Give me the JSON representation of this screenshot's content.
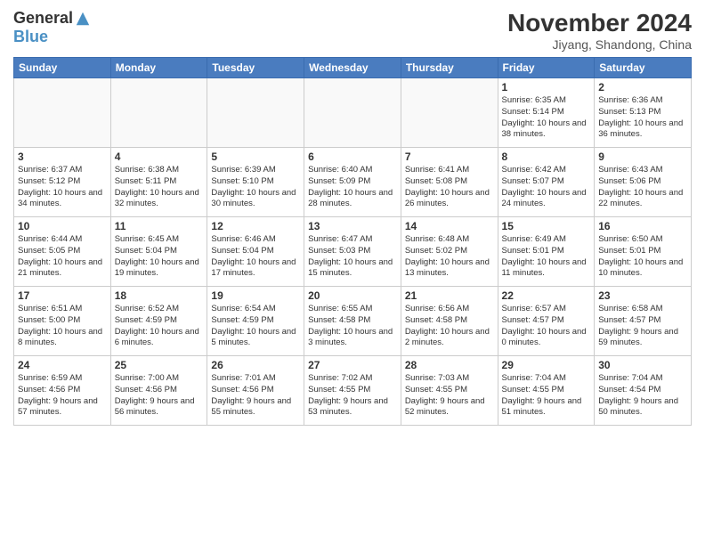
{
  "logo": {
    "general": "General",
    "blue": "Blue"
  },
  "title": "November 2024",
  "location": "Jiyang, Shandong, China",
  "days_of_week": [
    "Sunday",
    "Monday",
    "Tuesday",
    "Wednesday",
    "Thursday",
    "Friday",
    "Saturday"
  ],
  "weeks": [
    [
      {
        "day": "",
        "info": ""
      },
      {
        "day": "",
        "info": ""
      },
      {
        "day": "",
        "info": ""
      },
      {
        "day": "",
        "info": ""
      },
      {
        "day": "",
        "info": ""
      },
      {
        "day": "1",
        "info": "Sunrise: 6:35 AM\nSunset: 5:14 PM\nDaylight: 10 hours and 38 minutes."
      },
      {
        "day": "2",
        "info": "Sunrise: 6:36 AM\nSunset: 5:13 PM\nDaylight: 10 hours and 36 minutes."
      }
    ],
    [
      {
        "day": "3",
        "info": "Sunrise: 6:37 AM\nSunset: 5:12 PM\nDaylight: 10 hours and 34 minutes."
      },
      {
        "day": "4",
        "info": "Sunrise: 6:38 AM\nSunset: 5:11 PM\nDaylight: 10 hours and 32 minutes."
      },
      {
        "day": "5",
        "info": "Sunrise: 6:39 AM\nSunset: 5:10 PM\nDaylight: 10 hours and 30 minutes."
      },
      {
        "day": "6",
        "info": "Sunrise: 6:40 AM\nSunset: 5:09 PM\nDaylight: 10 hours and 28 minutes."
      },
      {
        "day": "7",
        "info": "Sunrise: 6:41 AM\nSunset: 5:08 PM\nDaylight: 10 hours and 26 minutes."
      },
      {
        "day": "8",
        "info": "Sunrise: 6:42 AM\nSunset: 5:07 PM\nDaylight: 10 hours and 24 minutes."
      },
      {
        "day": "9",
        "info": "Sunrise: 6:43 AM\nSunset: 5:06 PM\nDaylight: 10 hours and 22 minutes."
      }
    ],
    [
      {
        "day": "10",
        "info": "Sunrise: 6:44 AM\nSunset: 5:05 PM\nDaylight: 10 hours and 21 minutes."
      },
      {
        "day": "11",
        "info": "Sunrise: 6:45 AM\nSunset: 5:04 PM\nDaylight: 10 hours and 19 minutes."
      },
      {
        "day": "12",
        "info": "Sunrise: 6:46 AM\nSunset: 5:04 PM\nDaylight: 10 hours and 17 minutes."
      },
      {
        "day": "13",
        "info": "Sunrise: 6:47 AM\nSunset: 5:03 PM\nDaylight: 10 hours and 15 minutes."
      },
      {
        "day": "14",
        "info": "Sunrise: 6:48 AM\nSunset: 5:02 PM\nDaylight: 10 hours and 13 minutes."
      },
      {
        "day": "15",
        "info": "Sunrise: 6:49 AM\nSunset: 5:01 PM\nDaylight: 10 hours and 11 minutes."
      },
      {
        "day": "16",
        "info": "Sunrise: 6:50 AM\nSunset: 5:01 PM\nDaylight: 10 hours and 10 minutes."
      }
    ],
    [
      {
        "day": "17",
        "info": "Sunrise: 6:51 AM\nSunset: 5:00 PM\nDaylight: 10 hours and 8 minutes."
      },
      {
        "day": "18",
        "info": "Sunrise: 6:52 AM\nSunset: 4:59 PM\nDaylight: 10 hours and 6 minutes."
      },
      {
        "day": "19",
        "info": "Sunrise: 6:54 AM\nSunset: 4:59 PM\nDaylight: 10 hours and 5 minutes."
      },
      {
        "day": "20",
        "info": "Sunrise: 6:55 AM\nSunset: 4:58 PM\nDaylight: 10 hours and 3 minutes."
      },
      {
        "day": "21",
        "info": "Sunrise: 6:56 AM\nSunset: 4:58 PM\nDaylight: 10 hours and 2 minutes."
      },
      {
        "day": "22",
        "info": "Sunrise: 6:57 AM\nSunset: 4:57 PM\nDaylight: 10 hours and 0 minutes."
      },
      {
        "day": "23",
        "info": "Sunrise: 6:58 AM\nSunset: 4:57 PM\nDaylight: 9 hours and 59 minutes."
      }
    ],
    [
      {
        "day": "24",
        "info": "Sunrise: 6:59 AM\nSunset: 4:56 PM\nDaylight: 9 hours and 57 minutes."
      },
      {
        "day": "25",
        "info": "Sunrise: 7:00 AM\nSunset: 4:56 PM\nDaylight: 9 hours and 56 minutes."
      },
      {
        "day": "26",
        "info": "Sunrise: 7:01 AM\nSunset: 4:56 PM\nDaylight: 9 hours and 55 minutes."
      },
      {
        "day": "27",
        "info": "Sunrise: 7:02 AM\nSunset: 4:55 PM\nDaylight: 9 hours and 53 minutes."
      },
      {
        "day": "28",
        "info": "Sunrise: 7:03 AM\nSunset: 4:55 PM\nDaylight: 9 hours and 52 minutes."
      },
      {
        "day": "29",
        "info": "Sunrise: 7:04 AM\nSunset: 4:55 PM\nDaylight: 9 hours and 51 minutes."
      },
      {
        "day": "30",
        "info": "Sunrise: 7:04 AM\nSunset: 4:54 PM\nDaylight: 9 hours and 50 minutes."
      }
    ]
  ]
}
